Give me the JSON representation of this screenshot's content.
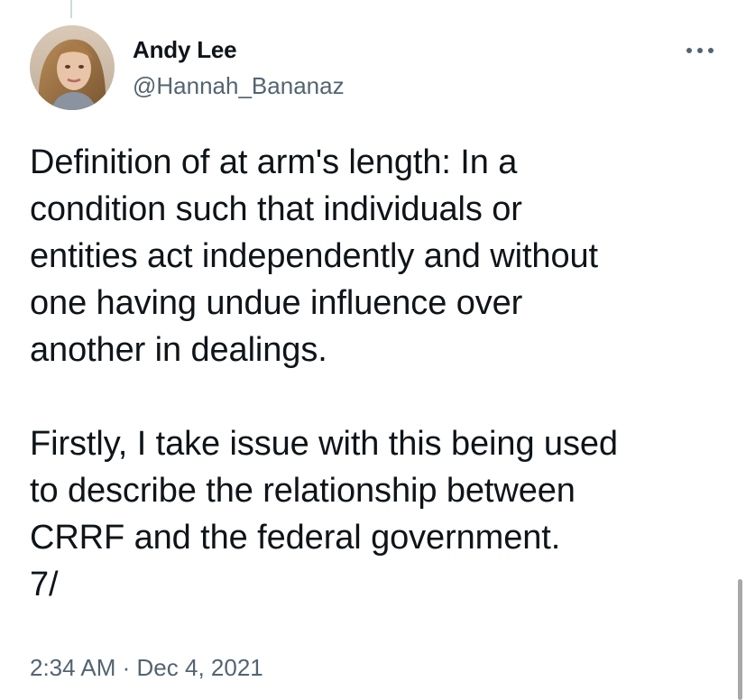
{
  "user": {
    "display_name": "Andy Lee",
    "handle": "@Hannah_Bananaz",
    "avatar_icon": "profile-photo"
  },
  "more_icon": "more-horizontal-icon",
  "tweet": {
    "paragraph1_lines": [
      "Definition of at arm's length: In a",
      "condition such that individuals or",
      "entities act independently and without",
      "one having undue influence over",
      "another in dealings."
    ],
    "paragraph2_lines": [
      "Firstly, I take issue with this being used",
      "to describe the relationship between",
      "CRRF and the federal government.",
      "7/"
    ],
    "time": "2:34 AM",
    "separator": "·",
    "date": "Dec 4, 2021"
  },
  "colors": {
    "text": "#0f1419",
    "secondary": "#536471",
    "background": "#ffffff"
  }
}
